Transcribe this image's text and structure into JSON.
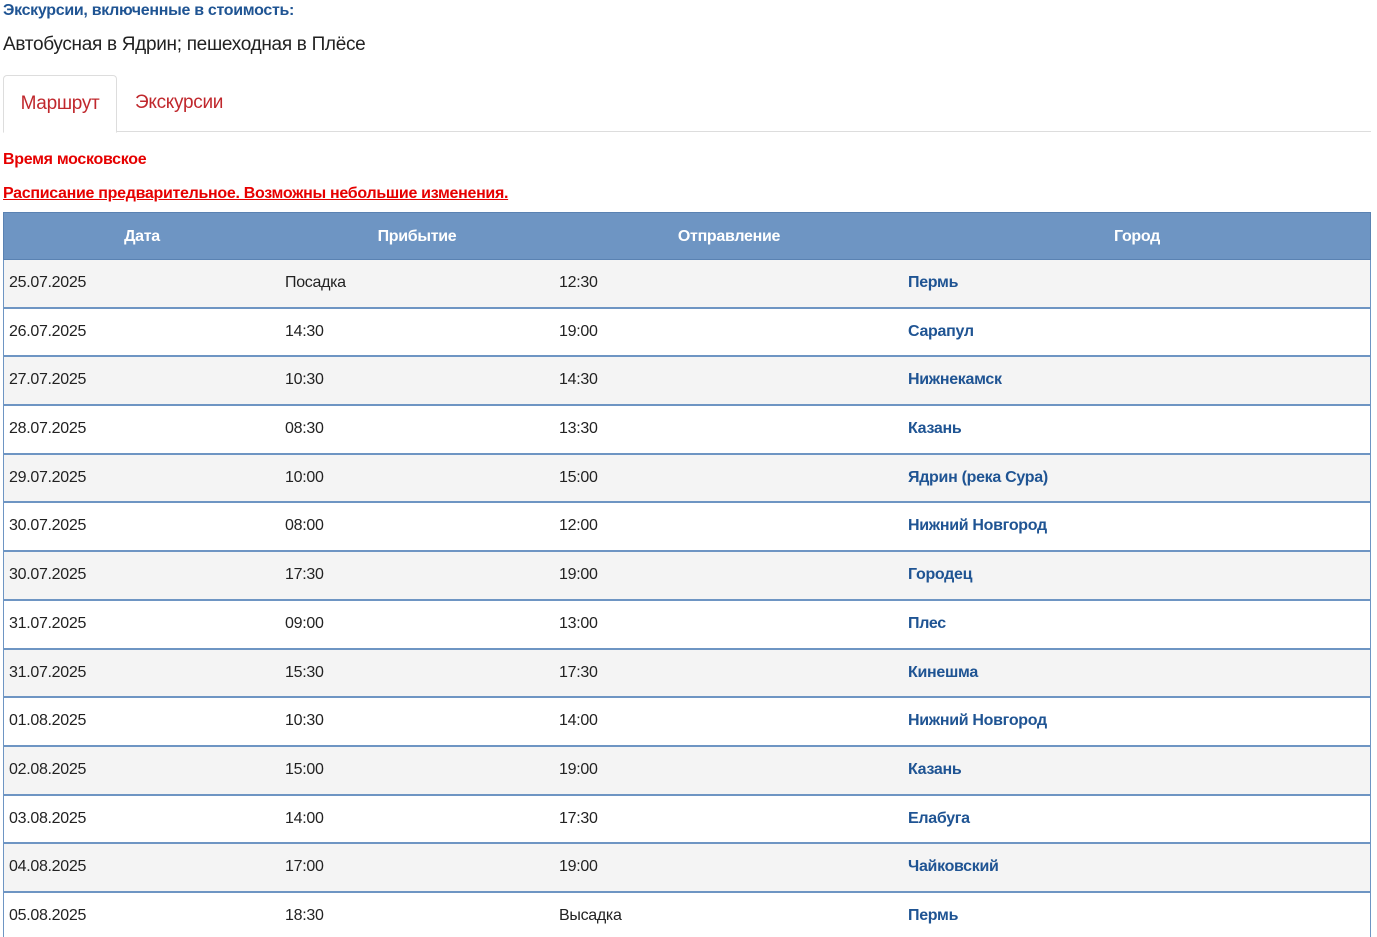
{
  "excursions": {
    "heading": "Экскурсии, включенные в стоимость:",
    "text": "Автобусная в Ядрин; пешеходная в Плёсе"
  },
  "tabs": [
    {
      "label": "Маршрут",
      "active": true
    },
    {
      "label": "Экскурсии",
      "active": false
    }
  ],
  "notices": {
    "time": "Время московское",
    "schedule": "Расписание предварительное. Возможны небольшие изменения."
  },
  "table": {
    "headers": [
      "Дата",
      "Прибытие",
      "Отправление",
      "Город"
    ],
    "rows": [
      {
        "date": "25.07.2025",
        "arrival": "Посадка",
        "departure": "12:30",
        "city": "Пермь"
      },
      {
        "date": "26.07.2025",
        "arrival": "14:30",
        "departure": "19:00",
        "city": "Сарапул"
      },
      {
        "date": "27.07.2025",
        "arrival": "10:30",
        "departure": "14:30",
        "city": "Нижнекамск"
      },
      {
        "date": "28.07.2025",
        "arrival": "08:30",
        "departure": "13:30",
        "city": "Казань"
      },
      {
        "date": "29.07.2025",
        "arrival": "10:00",
        "departure": "15:00",
        "city": "Ядрин (река Сура)"
      },
      {
        "date": "30.07.2025",
        "arrival": "08:00",
        "departure": "12:00",
        "city": "Нижний Новгород"
      },
      {
        "date": "30.07.2025",
        "arrival": "17:30",
        "departure": "19:00",
        "city": "Городец"
      },
      {
        "date": "31.07.2025",
        "arrival": "09:00",
        "departure": "13:00",
        "city": "Плес"
      },
      {
        "date": "31.07.2025",
        "arrival": "15:30",
        "departure": "17:30",
        "city": "Кинешма"
      },
      {
        "date": "01.08.2025",
        "arrival": "10:30",
        "departure": "14:00",
        "city": "Нижний Новгород"
      },
      {
        "date": "02.08.2025",
        "arrival": "15:00",
        "departure": "19:00",
        "city": "Казань"
      },
      {
        "date": "03.08.2025",
        "arrival": "14:00",
        "departure": "17:30",
        "city": "Елабуга"
      },
      {
        "date": "04.08.2025",
        "arrival": "17:00",
        "departure": "19:00",
        "city": "Чайковский"
      },
      {
        "date": "05.08.2025",
        "arrival": "18:30",
        "departure": "Высадка",
        "city": "Пермь"
      }
    ]
  },
  "colors": {
    "heading_blue": "#1f5493",
    "accent_red": "#e60000",
    "tab_red": "#c0282d",
    "table_header": "#6e95c3"
  }
}
